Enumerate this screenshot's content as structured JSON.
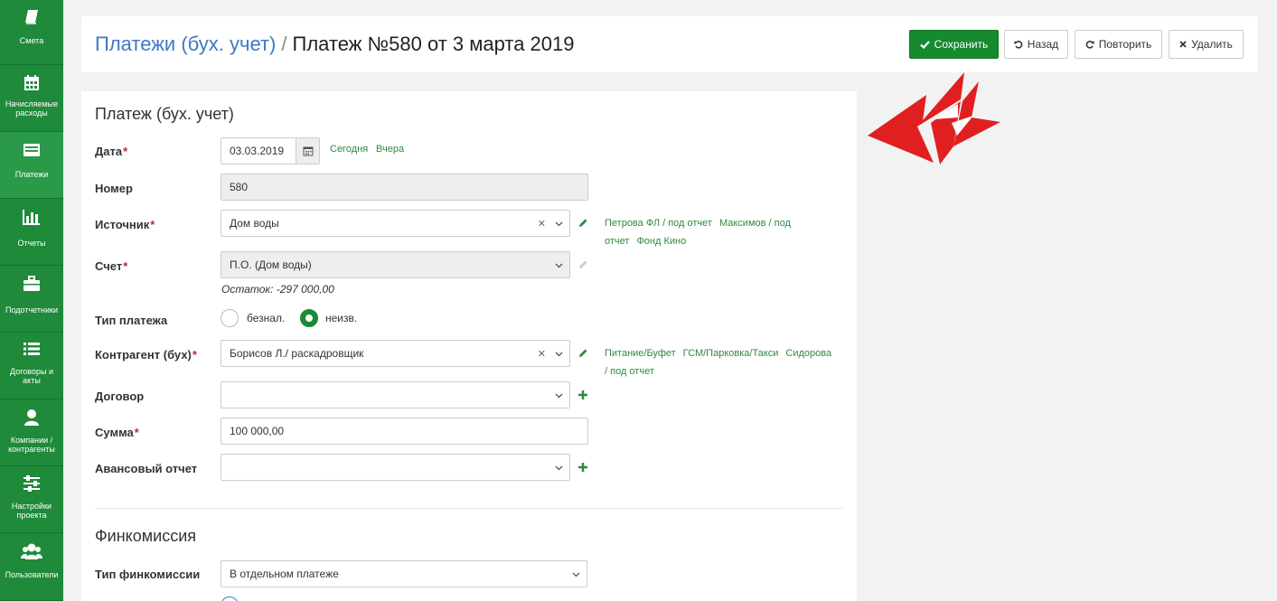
{
  "sidebar": {
    "items": [
      {
        "label": "Смета",
        "icon": "book-icon"
      },
      {
        "label": "Начисляемые расходы",
        "icon": "calendar-icon"
      },
      {
        "label": "Платежи",
        "icon": "payments-icon"
      },
      {
        "label": "Отчеты",
        "icon": "bar-chart-icon"
      },
      {
        "label": "Подотчетники",
        "icon": "briefcase-icon"
      },
      {
        "label": "Договоры и акты",
        "icon": "list-icon"
      },
      {
        "label": "Компании / контрагенты",
        "icon": "user-icon"
      },
      {
        "label": "Настройки проекта",
        "icon": "sliders-icon"
      },
      {
        "label": "Пользователи",
        "icon": "users-icon"
      }
    ]
  },
  "header": {
    "crumb_link": "Платежи (бух. учет)",
    "crumb_sep": "/",
    "crumb_current": "Платеж №580 от 3 марта 2019",
    "save_label": "Сохранить",
    "back_label": "Назад",
    "repeat_label": "Повторить",
    "delete_label": "Удалить"
  },
  "form": {
    "title": "Платеж (бух. учет)",
    "date_label": "Дата",
    "date_value": "03.03.2019",
    "today": "Сегодня",
    "yesterday": "Вчера",
    "number_label": "Номер",
    "number_value": "580",
    "source_label": "Источник",
    "source_value": "Дом воды",
    "source_hints": [
      "Петрова ФЛ / под отчет",
      "Максимов / под",
      "отчет",
      "Фонд Кино"
    ],
    "account_label": "Счет",
    "account_value": "П.О. (Дом воды)",
    "balance": "Остаток: -297 000,00",
    "paytype_label": "Тип платежа",
    "paytype_opt1": "безнал.",
    "paytype_opt2": "неизв.",
    "paytype_selected": "неизв.",
    "counterparty_label": "Контрагент (бух)",
    "counterparty_value": "Борисов Л./ раскадровщик",
    "counterparty_hints": [
      "Питание/Буфет",
      "ГСМ/Парковка/Такси",
      "Сидорова",
      "/ под отчет"
    ],
    "contract_label": "Договор",
    "contract_value": "",
    "sum_label": "Сумма",
    "sum_value": "100 000,00",
    "advance_label": "Авансовый отчет",
    "advance_value": "",
    "req_mark": "*"
  },
  "fincommission": {
    "title": "Финкомиссия",
    "type_label": "Тип финкомиссии",
    "type_value": "В отдельном платеже"
  },
  "colors": {
    "sidebar": "#1e8a3a",
    "primary": "#168a2e",
    "link": "#3f78c8",
    "arrow": "#e02020"
  }
}
